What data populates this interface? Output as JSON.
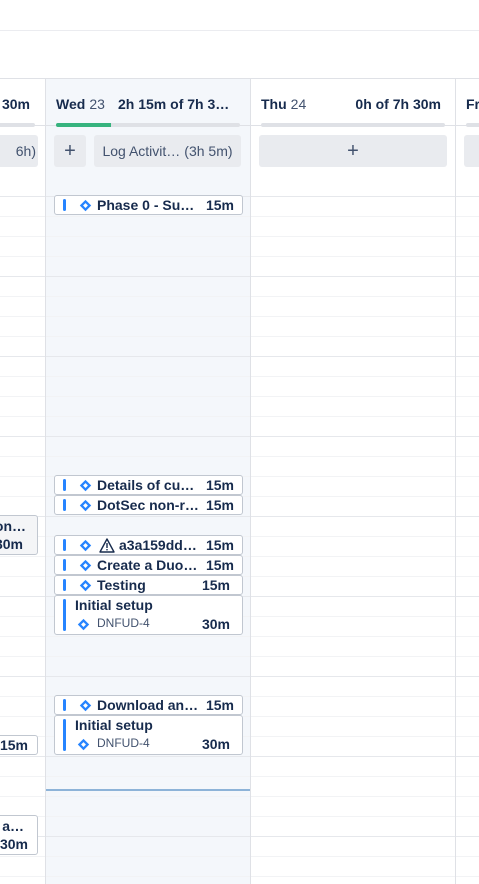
{
  "colors": {
    "accent": "#2684ff",
    "progress": "#36b37e",
    "jira": "#2684ff",
    "today_bg": "#f4f7fb"
  },
  "prev_col": {
    "total": "30m",
    "log_button": "6h)",
    "entries": [
      {
        "title": "on…",
        "duration": "30m"
      },
      {
        "duration": "15m"
      },
      {
        "title": "a…",
        "duration": "30m"
      }
    ]
  },
  "wed": {
    "day": "Wed",
    "date": "23",
    "total": "2h 15m of 7h 3…",
    "progress": 0.3,
    "log_button": "Log Activit…",
    "log_hours": "(3h 5m)",
    "entries": [
      {
        "title": "Phase 0 - Su…",
        "duration": "15m",
        "icon": "jira-icon"
      },
      {
        "title": "Details of cu…",
        "duration": "15m",
        "icon": "jira-icon"
      },
      {
        "title": "DotSec non-r…",
        "duration": "15m",
        "icon": "jira-icon"
      },
      {
        "title": "a3a159dd…",
        "duration": "15m",
        "icon": "warning-icon"
      },
      {
        "title": "Create a Duo…",
        "duration": "15m",
        "icon": "jira-icon"
      },
      {
        "title": "Testing",
        "duration": "15m",
        "icon": "jira-icon"
      },
      {
        "title": "Initial setup",
        "key": "DNFUD-4",
        "duration": "30m",
        "icon": "jira-icon"
      },
      {
        "title": "Download an…",
        "duration": "15m",
        "icon": "jira-icon"
      },
      {
        "title": "Initial setup",
        "key": "DNFUD-4",
        "duration": "30m",
        "icon": "jira-icon"
      }
    ]
  },
  "thu": {
    "day": "Thu",
    "date": "24",
    "total": "0h of 7h 30m",
    "progress": 0
  },
  "fri": {
    "day": "Fr"
  }
}
